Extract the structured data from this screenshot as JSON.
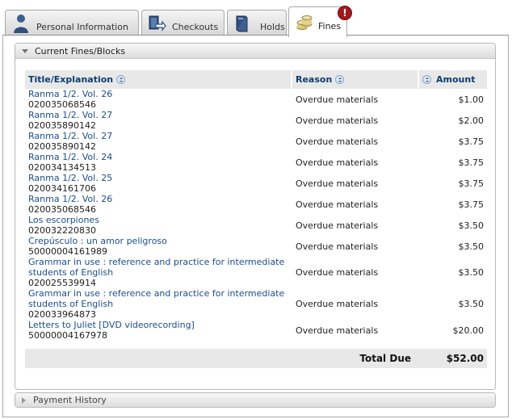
{
  "tabs": [
    {
      "label": "Personal Information",
      "icon": "person-icon"
    },
    {
      "label": "Checkouts",
      "icon": "checkout-arrow-icon"
    },
    {
      "label": "Holds",
      "icon": "book-icon"
    },
    {
      "label": "Fines",
      "icon": "coins-icon",
      "active": true
    }
  ],
  "alert_badge": "!",
  "fines_panel": {
    "header": "Current Fines/Blocks",
    "columns": {
      "title": "Title/Explanation",
      "reason": "Reason",
      "amount": "Amount"
    },
    "rows": [
      {
        "title": "Ranma 1/2. Vol. 26",
        "barcode": "020035068546",
        "reason": "Overdue materials",
        "amount": "$1.00"
      },
      {
        "title": "Ranma 1/2. Vol. 27",
        "barcode": "020035890142",
        "reason": "Overdue materials",
        "amount": "$2.00"
      },
      {
        "title": "Ranma 1/2. Vol. 27",
        "barcode": "020035890142",
        "reason": "Overdue materials",
        "amount": "$3.75"
      },
      {
        "title": "Ranma 1/2. Vol. 24",
        "barcode": "020034134513",
        "reason": "Overdue materials",
        "amount": "$3.75"
      },
      {
        "title": "Ranma 1/2. Vol. 25",
        "barcode": "020034161706",
        "reason": "Overdue materials",
        "amount": "$3.75"
      },
      {
        "title": "Ranma 1/2. Vol. 26",
        "barcode": "020035068546",
        "reason": "Overdue materials",
        "amount": "$3.75"
      },
      {
        "title": "Los escorpiones",
        "barcode": "020032220830",
        "reason": "Overdue materials",
        "amount": "$3.50"
      },
      {
        "title": "Crepúsculo : un amor peligroso",
        "barcode": "50000004161989",
        "reason": "Overdue materials",
        "amount": "$3.50"
      },
      {
        "title": "Grammar in use : reference and practice for intermediate students of English",
        "barcode": "020025539914",
        "reason": "Overdue materials",
        "amount": "$3.50"
      },
      {
        "title": "Grammar in use : reference and practice for intermediate students of English",
        "barcode": "020033964873",
        "reason": "Overdue materials",
        "amount": "$3.50"
      },
      {
        "title": "Letters to Juliet [DVD videorecording]",
        "barcode": "50000004167978",
        "reason": "Overdue materials",
        "amount": "$20.00"
      }
    ],
    "total_label": "Total Due",
    "total_amount": "$52.00"
  },
  "payment_panel": {
    "header": "Payment History"
  },
  "colors": {
    "link": "#1a4e8c",
    "header_text": "#0d3d6e",
    "alert": "#a3181c",
    "row_band": "#e8e8e8"
  }
}
